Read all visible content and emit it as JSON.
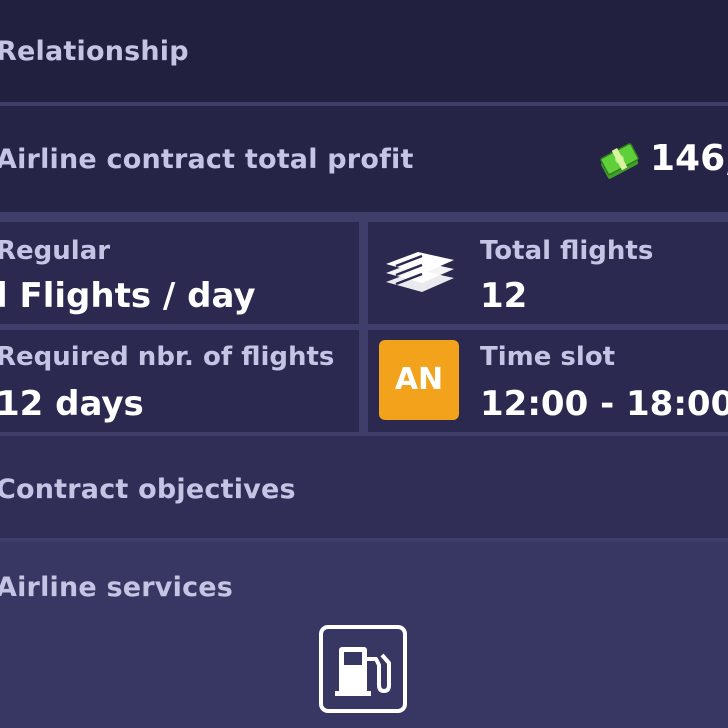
{
  "relationship": {
    "label": "Relationship"
  },
  "profit": {
    "label": "Airline contract total profit",
    "value": "146,",
    "icon": "cash-icon"
  },
  "stats": {
    "regular": {
      "label": "Regular",
      "value": "l Flights / day"
    },
    "total_flights": {
      "label": "Total flights",
      "value": "12",
      "icon": "flights-stack-icon"
    },
    "required": {
      "label": "Required nbr. of flights",
      "value": "12 days"
    },
    "time_slot": {
      "label": "Time slot",
      "value": "12:00 - 18:00",
      "badge": "AN"
    }
  },
  "objectives": {
    "label": "Contract objectives"
  },
  "services": {
    "label": "Airline services",
    "items": [
      {
        "icon": "fuel-pump-icon"
      }
    ]
  },
  "colors": {
    "background": "#2d2b52",
    "label": "#c6c4e4",
    "value": "#ffffff",
    "badge": "#f3a21c",
    "cash": "#5fcf3a"
  }
}
